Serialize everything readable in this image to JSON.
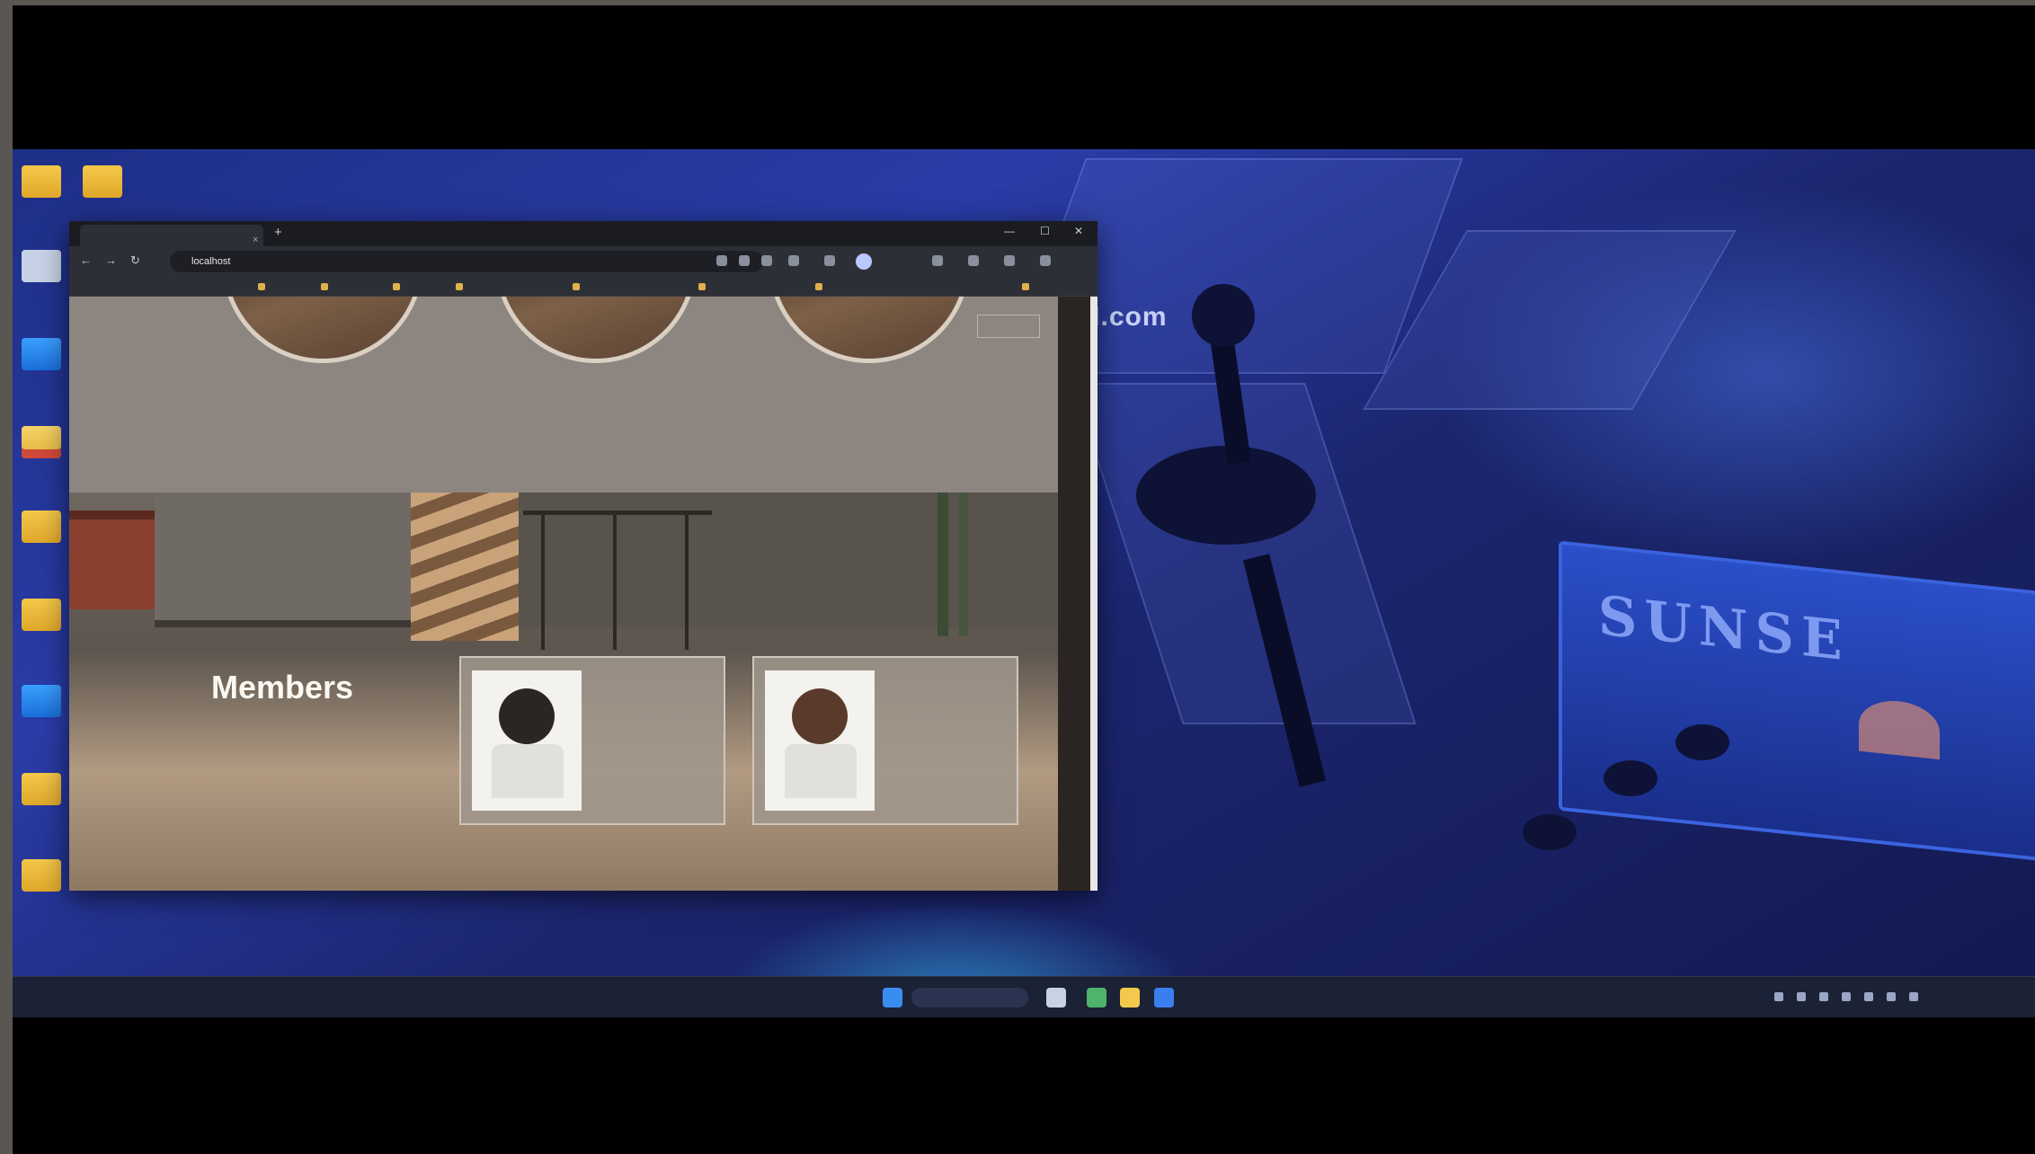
{
  "watermark": "www.BANDICAM.com",
  "desktop": {
    "sign_text": "SUNSE",
    "icons": [
      {
        "label": "",
        "kind": "folder"
      },
      {
        "label": "",
        "kind": "folder"
      },
      {
        "label": "",
        "kind": "bin"
      },
      {
        "label": "",
        "kind": "pc"
      },
      {
        "label": "",
        "kind": "folder-pic"
      },
      {
        "label": "",
        "kind": "folder"
      },
      {
        "label": "",
        "kind": "folder"
      },
      {
        "label": "",
        "kind": "pc"
      },
      {
        "label": "",
        "kind": "folder"
      },
      {
        "label": "",
        "kind": "folder"
      }
    ]
  },
  "browser": {
    "tab_title": "",
    "new_tab": "+",
    "close": "×",
    "window_controls": [
      "—",
      "☐",
      "✕"
    ],
    "nav": [
      "←",
      "→",
      "↻"
    ],
    "address": "localhost",
    "bookmarks": [
      "",
      "",
      "",
      "",
      "",
      "",
      "",
      ""
    ]
  },
  "page": {
    "logo": "",
    "inline_nav": "",
    "header_button": "",
    "feature_captions": [
      "",
      "",
      ""
    ],
    "members": {
      "title": "Members",
      "subtitle": "",
      "cards": [
        {
          "name": "",
          "role": "",
          "hair": "#2a2624"
        },
        {
          "name": "",
          "role": "",
          "hair": "#5a3a2a"
        }
      ]
    }
  },
  "taskbar": {
    "search_placeholder": "",
    "clock_time": "",
    "clock_date": ""
  },
  "colors": {
    "desktop_accent": "#2a3ca8",
    "page_overlay": "#8d8680",
    "card_bg": "#a0968c"
  }
}
